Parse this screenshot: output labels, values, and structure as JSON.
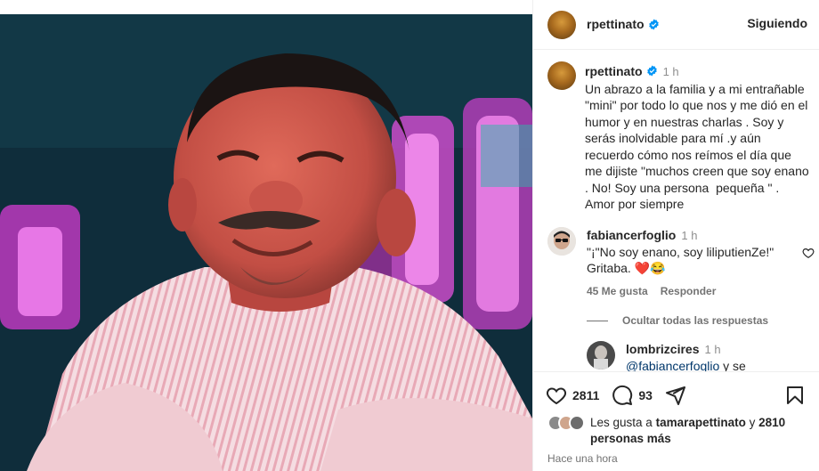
{
  "post": {
    "author": "rpettinato",
    "follow_label": "Siguiendo",
    "caption_author": "rpettinato",
    "caption_time": "1 h",
    "caption_text": "Un abrazo a la familia y a mi entrañable \"mini\" por todo lo que nos y me dió en el humor y en nuestras charlas . Soy y serás inolvidable para mí .y aún recuerdo cómo nos reímos el día que me dijiste \"muchos creen que soy enano . No! Soy una persona  pequeña \" . Amor por siempre"
  },
  "comments": [
    {
      "author": "fabiancerfoglio",
      "time": "1 h",
      "text": "\"¡\"No soy enano, soy liliputienZe!\" Gritaba. ❤️😂",
      "likes": "45 Me gusta",
      "reply_label": "Responder",
      "hide_replies": "Ocultar todas las respuestas"
    },
    {
      "author": "lombrizcires",
      "time": "1 h",
      "mention": "@fabiancerfoglio",
      "text_after": "y se"
    }
  ],
  "actions": {
    "like_count": "2811",
    "comment_count": "93"
  },
  "likes": {
    "prefix": "Les gusta a",
    "user": "tamarapettinato",
    "connector": "y",
    "others": "2810 personas más"
  },
  "timestamp": "Hace una hora",
  "colors": {
    "verified": "#0095f6",
    "heart_red": "#ed4956",
    "link": "#00376b"
  },
  "icons": [
    "verified-badge-icon",
    "heart-icon",
    "comment-icon",
    "share-icon",
    "save-icon"
  ]
}
